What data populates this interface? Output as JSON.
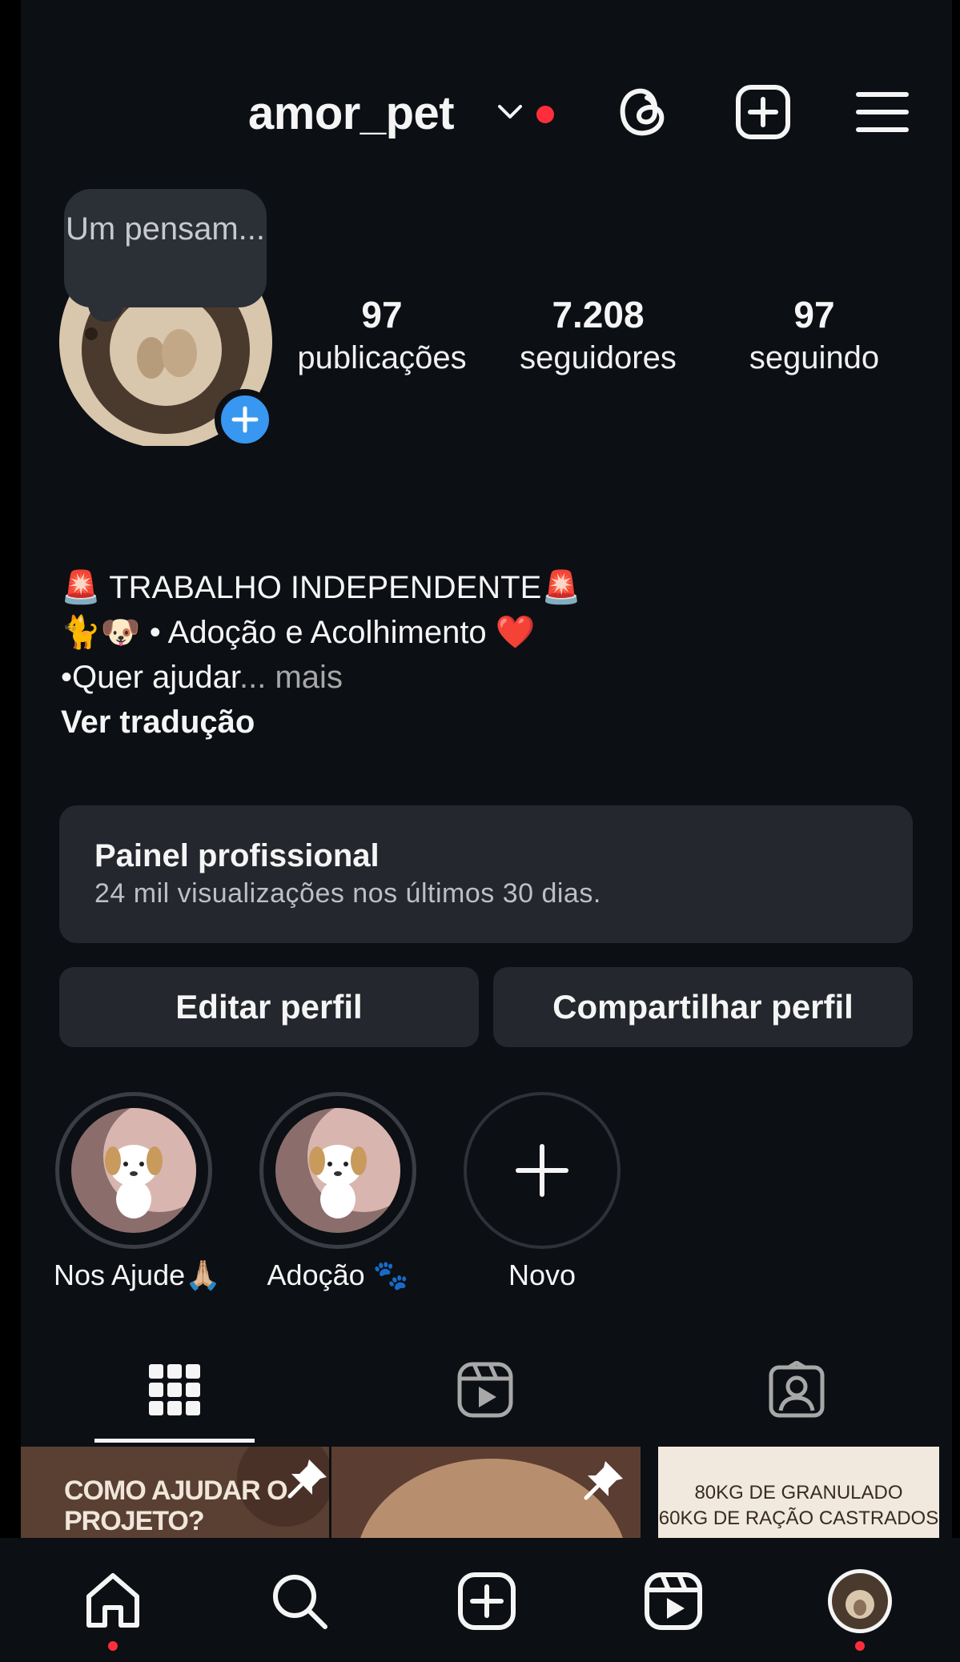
{
  "header": {
    "username": "amor_pet"
  },
  "avatar": {
    "note_bubble": "Um pensam..."
  },
  "stats": [
    {
      "value": "97",
      "label": "publicações"
    },
    {
      "value": "7.208",
      "label": "seguidores"
    },
    {
      "value": "97",
      "label": "seguindo"
    }
  ],
  "bio": {
    "line1": "🚨 TRABALHO INDEPENDENTE🚨",
    "line2": "🐈🐶 • Adoção e Acolhimento ❤️",
    "line3": "•Quer ajudar",
    "more": "... mais",
    "translate": "Ver tradução"
  },
  "panel": {
    "title": "Painel profissional",
    "subtitle": "24 mil visualizações nos últimos 30 dias."
  },
  "buttons": {
    "edit": "Editar perfil",
    "share": "Compartilhar perfil"
  },
  "highlights": [
    {
      "label": "Nos Ajude🙏🏼"
    },
    {
      "label": "Adoção 🐾"
    },
    {
      "label": "Novo"
    }
  ],
  "posts": [
    {
      "text": "COMO AJUDAR O PROJETO?"
    },
    {
      "text": ""
    },
    {
      "line1": "80KG DE GRANULADO",
      "line2": "60KG DE RAÇÃO CASTRADOS"
    }
  ],
  "colors": {
    "background": "#0c0f14",
    "card": "#24272d",
    "accent_blue": "#3897f0",
    "notification_red": "#ff2e3a"
  },
  "icons": {
    "header": [
      "threads-icon",
      "plus-square-icon",
      "menu-icon"
    ],
    "tabs": [
      "grid-icon",
      "reels-icon",
      "tagged-icon"
    ],
    "nav": [
      "home-icon",
      "search-icon",
      "create-icon",
      "reels-icon",
      "profile-avatar"
    ]
  }
}
